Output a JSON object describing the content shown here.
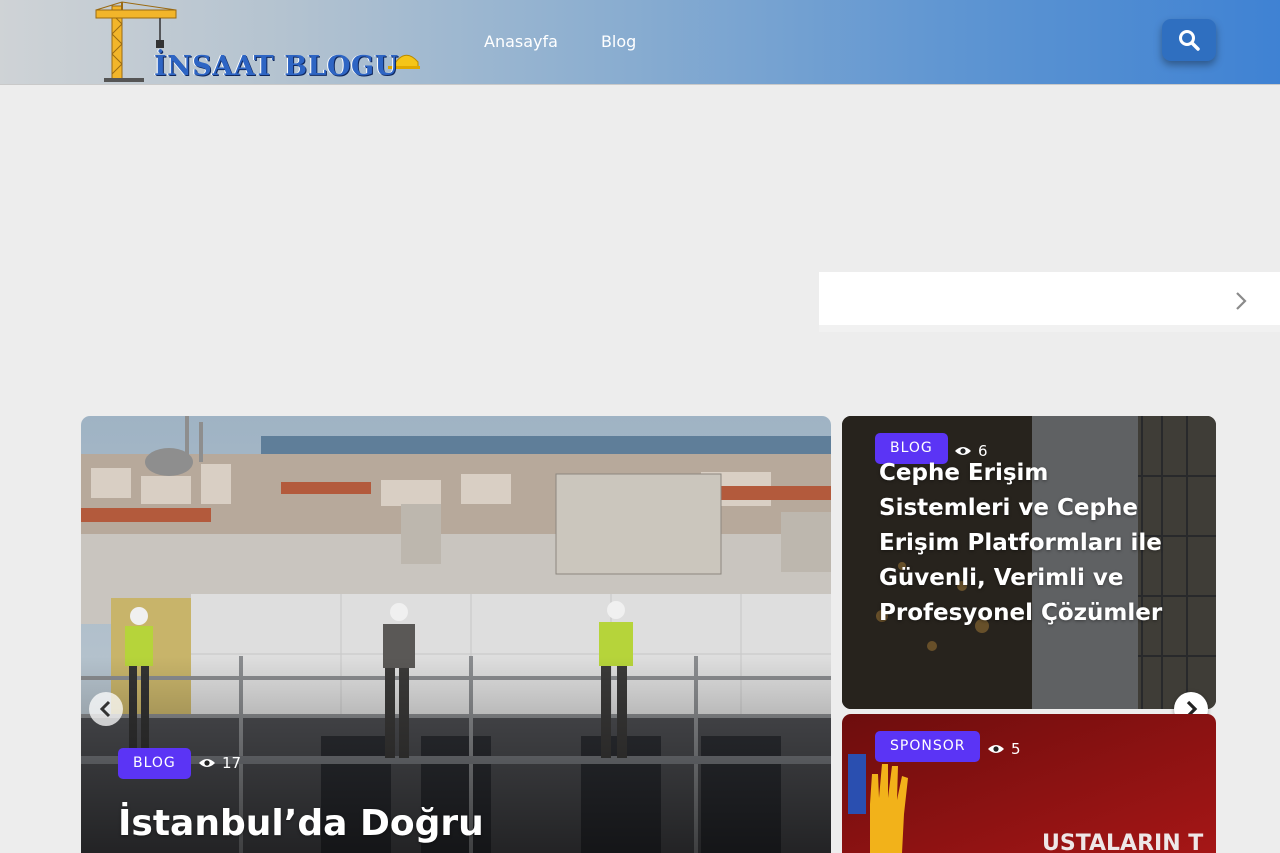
{
  "header": {
    "logo_text": "İNSAAT BLOGU",
    "nav": [
      "Anasayfa",
      "Blog"
    ]
  },
  "icons": {
    "search": "search-icon",
    "next": "chevron-right-icon",
    "prev": "chevron-left-icon",
    "views": "eye-icon"
  },
  "featured": {
    "main": {
      "category": "BLOG",
      "views": "17",
      "title": "İstanbul’da Doğru"
    },
    "side": [
      {
        "category": "BLOG",
        "views": "6",
        "title": "Cephe Erişim Sistemleri ve Cephe Erişim Platformları ile Güvenli, Verimli ve Profesyonel Çözümler"
      },
      {
        "category": "SPONSOR",
        "views": "5",
        "image_text": "USTALARIN T"
      }
    ]
  },
  "colors": {
    "badge": "#5b34f5",
    "search_button": "#2f6fc0",
    "header_end": "#3f82d3"
  }
}
